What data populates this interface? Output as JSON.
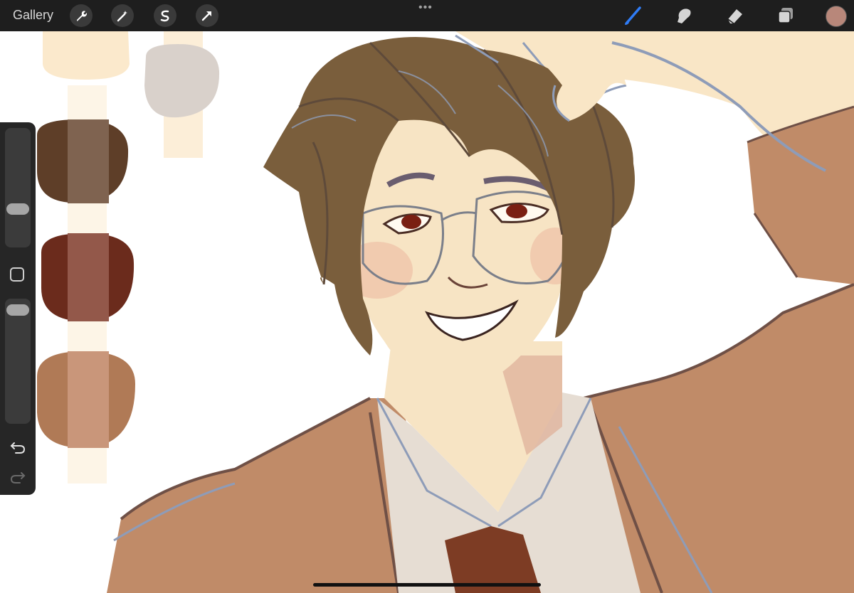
{
  "toolbar": {
    "gallery_label": "Gallery",
    "left_tools": [
      {
        "name": "actions-wrench-icon"
      },
      {
        "name": "adjustments-magic-wand-icon"
      },
      {
        "name": "selection-s-icon"
      },
      {
        "name": "transform-arrow-icon"
      }
    ],
    "right_tools": [
      {
        "name": "brush-icon",
        "active": true
      },
      {
        "name": "smudge-icon",
        "active": false
      },
      {
        "name": "eraser-icon",
        "active": false
      },
      {
        "name": "layers-icon",
        "active": false
      }
    ],
    "more_icon": "more-dots-icon",
    "current_color": "#b8877a"
  },
  "sidebar": {
    "brush_size_level": 0.3,
    "opacity_level": 0.95,
    "modify_icon": "square-modify-icon",
    "undo_icon": "undo-arrow-icon",
    "redo_icon": "redo-arrow-icon"
  },
  "palette_swatches": [
    {
      "name": "swatch-cream",
      "colors": [
        "#fbe9cc",
        "#fbe9cc"
      ]
    },
    {
      "name": "swatch-grey-beige",
      "colors": [
        "#d9d1cb",
        "#e8ddd3"
      ]
    },
    {
      "name": "swatch-dark-brown",
      "colors": [
        "#5e3e28",
        "#7f6350"
      ]
    },
    {
      "name": "swatch-red-brown",
      "colors": [
        "#6b2b1c",
        "#93584a"
      ]
    },
    {
      "name": "swatch-tan",
      "colors": [
        "#b07a56",
        "#c9967a"
      ]
    }
  ],
  "artwork": {
    "skin": "#f7e4c4",
    "skin_shadow": "#e8b9a2",
    "hair": "#7a5e3c",
    "hair_line": "#5e4a3a",
    "jacket": "#c08b68",
    "jacket_line": "#6f5046",
    "shirt": "#e6ddd3",
    "tie": "#7d3c24",
    "sketch_blue": "#8e9cb8",
    "eye": "#7a1f12"
  }
}
